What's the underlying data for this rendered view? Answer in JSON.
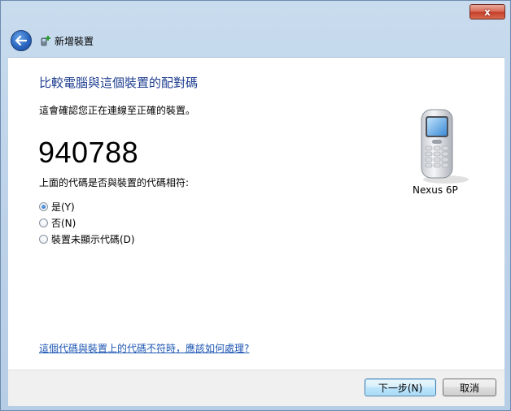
{
  "window": {
    "close_label": "x"
  },
  "header": {
    "title": "新增裝置"
  },
  "main": {
    "heading": "比較電腦與這個裝置的配對碼",
    "confirm_text": "這會確認您正在連線至正確的裝置。",
    "passkey": "940788",
    "question": "上面的代碼是否與裝置的代碼相符:",
    "options": [
      {
        "label": "是(Y)",
        "checked": true
      },
      {
        "label": "否(N)",
        "checked": false
      },
      {
        "label": "裝置未顯示代碼(D)",
        "checked": false
      }
    ],
    "device_name": "Nexus 6P",
    "help_link": "這個代碼與裝置上的代碼不符時，應該如何處理?"
  },
  "footer": {
    "next_label": "下一步(N)",
    "cancel_label": "取消"
  },
  "colors": {
    "heading": "#1e3d8f",
    "link": "#1d56b3",
    "frame": "#bfd4ea"
  },
  "icons": {
    "back": "back-arrow-icon",
    "wizard": "add-device-icon",
    "device": "mobile-phone-icon"
  }
}
